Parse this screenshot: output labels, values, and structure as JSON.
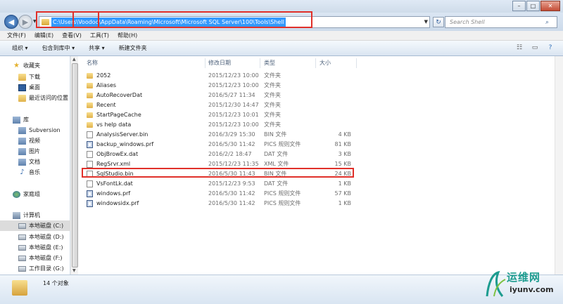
{
  "window": {
    "minimize_glyph": "–",
    "maximize_glyph": "□",
    "close_glyph": "✕"
  },
  "nav": {
    "back_glyph": "◀",
    "forward_glyph": "▶",
    "recent_glyph": "▼",
    "address": "C:\\Users\\Voodoo\\AppData\\Roaming\\Microsoft\\Microsoft SQL Server\\100\\Tools\\Shell",
    "refresh_glyph": "↻",
    "search_placeholder": "Search Shell",
    "search_icon": "search-icon"
  },
  "menu": [
    "文件(F)",
    "编辑(E)",
    "查看(V)",
    "工具(T)",
    "帮助(H)"
  ],
  "toolbar": {
    "organize": "组织 ▾",
    "include": "包含到库中 ▾",
    "share": "共享 ▾",
    "new_folder": "新建文件夹"
  },
  "sidebar": {
    "favorites": "收藏夹",
    "downloads": "下载",
    "desktop": "桌面",
    "recent": "最近访问的位置",
    "libraries": "库",
    "subversion": "Subversion",
    "videos": "视频",
    "pictures": "图片",
    "documents": "文档",
    "music": "音乐",
    "homegroup": "家庭组",
    "computer": "计算机",
    "drive_c": "本地磁盘 (C:)",
    "drive_d": "本地磁盘 (D:)",
    "drive_e": "本地磁盘 (E:)",
    "drive_f": "本地磁盘 (F:)",
    "drive_g": "工作目录 (G:)"
  },
  "columns": {
    "name": "名称",
    "modified": "修改日期",
    "type": "类型",
    "size": "大小"
  },
  "files": [
    {
      "name": "2052",
      "date": "2015/12/23 10:00",
      "type": "文件夹",
      "size": ""
    },
    {
      "name": "Aliases",
      "date": "2015/12/23 10:00",
      "type": "文件夹",
      "size": ""
    },
    {
      "name": "AutoRecoverDat",
      "date": "2016/5/27 11:34",
      "type": "文件夹",
      "size": ""
    },
    {
      "name": "Recent",
      "date": "2015/12/30 14:47",
      "type": "文件夹",
      "size": ""
    },
    {
      "name": "StartPageCache",
      "date": "2015/12/23 10:01",
      "type": "文件夹",
      "size": ""
    },
    {
      "name": "vs help data",
      "date": "2015/12/23 10:00",
      "type": "文件夹",
      "size": ""
    },
    {
      "name": "AnalysisServer.bin",
      "date": "2016/3/29 15:30",
      "type": "BIN 文件",
      "size": "4 KB"
    },
    {
      "name": "backup_windows.prf",
      "date": "2016/5/30 11:42",
      "type": "PICS 规则文件",
      "size": "81 KB"
    },
    {
      "name": "ObjBrowEx.dat",
      "date": "2016/2/2 18:47",
      "type": "DAT 文件",
      "size": "3 KB"
    },
    {
      "name": "RegSrvr.xml",
      "date": "2015/12/23 11:35",
      "type": "XML 文件",
      "size": "15 KB"
    },
    {
      "name": "SqlStudio.bin",
      "date": "2016/5/30 11:43",
      "type": "BIN 文件",
      "size": "24 KB"
    },
    {
      "name": "VsFontLk.dat",
      "date": "2015/12/23 9:53",
      "type": "DAT 文件",
      "size": "1 KB"
    },
    {
      "name": "windows.prf",
      "date": "2016/5/30 11:42",
      "type": "PICS 规则文件",
      "size": "57 KB"
    },
    {
      "name": "windowsidx.prf",
      "date": "2016/5/30 11:42",
      "type": "PICS 规则文件",
      "size": "1 KB"
    }
  ],
  "status": {
    "count": "14 个对象"
  },
  "watermark": {
    "cn": "运维网",
    "en": "iyunv.com"
  },
  "colors": {
    "highlight": "#e0302a",
    "selection": "#3399ff"
  }
}
